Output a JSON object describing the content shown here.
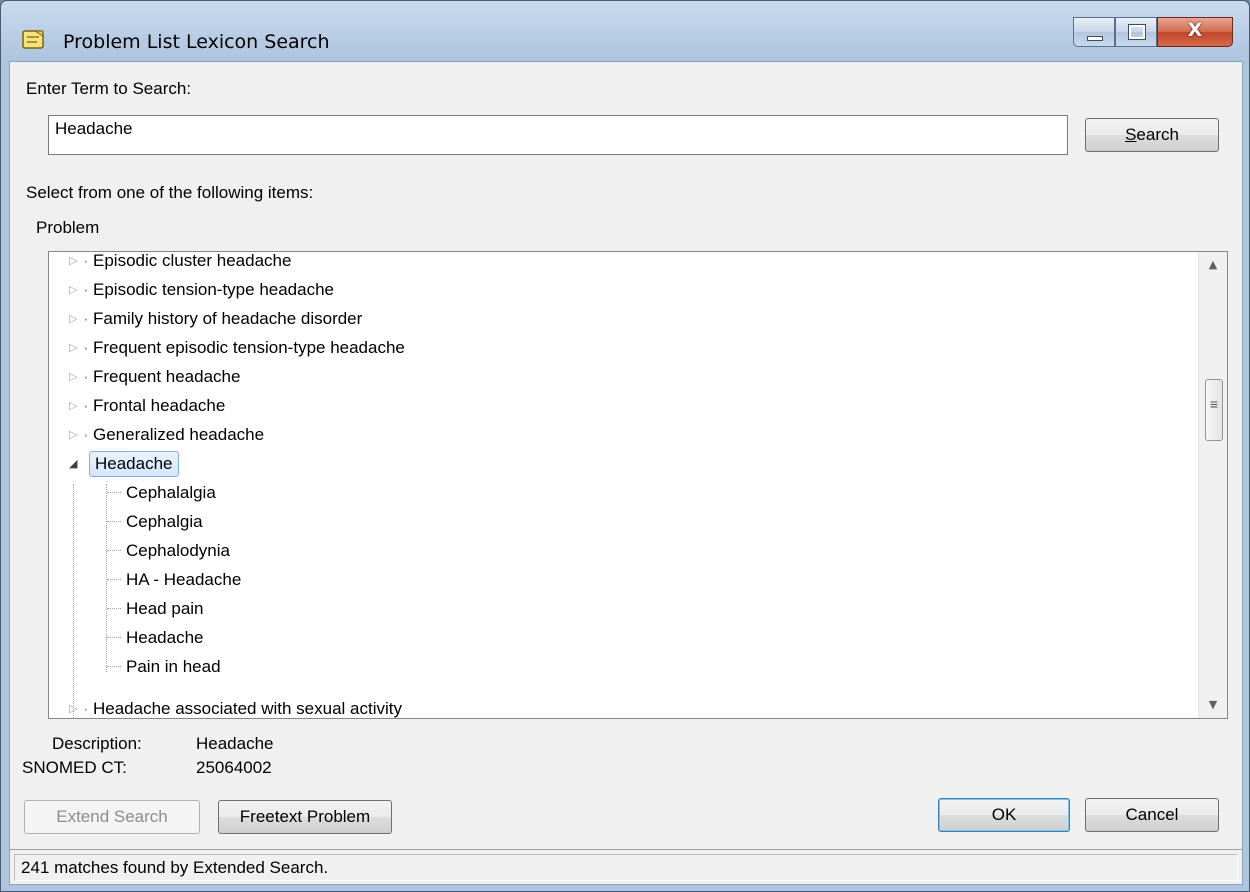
{
  "window": {
    "title": "Problem List  Lexicon Search",
    "minimize_icon": "minimize-icon",
    "maximize_icon": "maximize-icon",
    "close_glyph": "X"
  },
  "search": {
    "label": "Enter Term to Search:",
    "value": "Headache",
    "button_label": "Search"
  },
  "results": {
    "select_label": "Select from one of the following items:",
    "column_header": "Problem",
    "items": [
      "Episodic cluster headache",
      "Episodic tension-type headache",
      "Family history of headache disorder",
      "Frequent episodic tension-type headache",
      "Frequent headache",
      "Frontal headache",
      "Generalized headache"
    ],
    "expanded_item": "Headache",
    "children": [
      "Cephalalgia",
      "Cephalgia",
      "Cephalodynia",
      "HA - Headache",
      "Head pain",
      "Headache",
      "Pain in head"
    ],
    "next_item": "Headache associated with sexual activity"
  },
  "details": {
    "description_label": "Description:",
    "description_value": "Headache",
    "code_label": "SNOMED CT:",
    "code_value": "25064002"
  },
  "buttons": {
    "extend_search": "Extend Search",
    "freetext_problem": "Freetext Problem",
    "ok": "OK",
    "cancel": "Cancel"
  },
  "status": {
    "text": "241 matches found by Extended Search."
  },
  "colors": {
    "selection_border": "#84acdd",
    "selection_fill": "#d3e6fb",
    "close_button": "#c2452a"
  }
}
